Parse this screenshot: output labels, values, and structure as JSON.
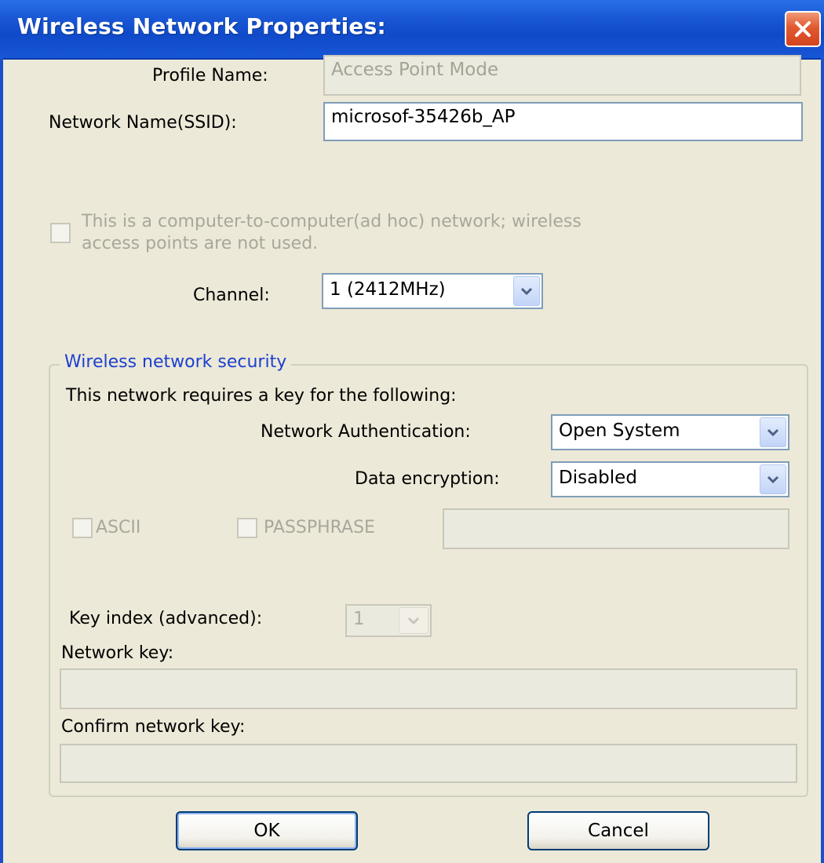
{
  "window": {
    "title": "Wireless Network Properties:",
    "close_icon": "close-x-icon",
    "accent": "#1a58d6",
    "close_color": "#e2592f"
  },
  "profile": {
    "label": "Profile Name:",
    "value": "Access Point Mode"
  },
  "ssid": {
    "label": "Network Name(SSID):",
    "value": "microsof-35426b_AP"
  },
  "adhoc": {
    "line1": "This is a computer-to-computer(ad hoc) network; wireless",
    "line2": "access points are not used."
  },
  "channel": {
    "label": "Channel:",
    "value": "1  (2412MHz)"
  },
  "security": {
    "group_title": "Wireless network security",
    "intro": "This network requires a key for the following:",
    "auth_label": "Network Authentication:",
    "auth_value": "Open System",
    "enc_label": "Data encryption:",
    "enc_value": "Disabled",
    "ascii_label": "ASCII",
    "passphrase_label": "PASSPHRASE",
    "key_index_label": "Key index (advanced):",
    "key_index_value": "1",
    "network_key_label": "Network key:",
    "confirm_key_label": "Confirm network key:"
  },
  "buttons": {
    "ok": "OK",
    "cancel": "Cancel"
  }
}
